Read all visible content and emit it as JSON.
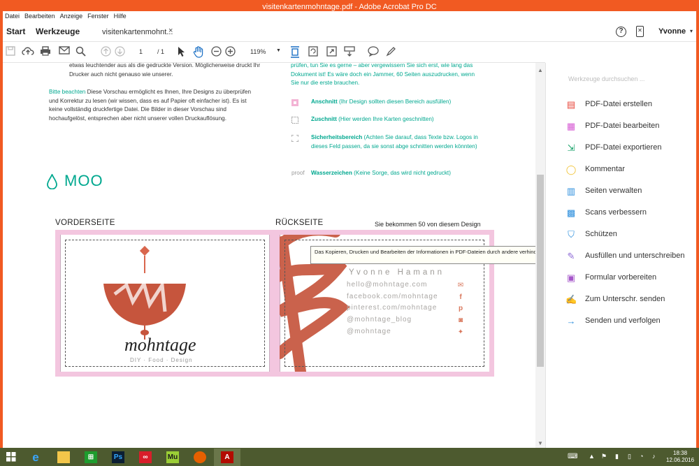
{
  "window": {
    "title": "visitenkartenmohntage.pdf - Adobe Acrobat Pro DC"
  },
  "menu": [
    "Datei",
    "Bearbeiten",
    "Anzeige",
    "Fenster",
    "Hilfe"
  ],
  "tabs": {
    "start": "Start",
    "tools": "Werkzeuge",
    "document": "visitenkartenmohnt...",
    "close": "×"
  },
  "account": {
    "user": "Yvonne"
  },
  "toolbar": {
    "page_current": "1",
    "page_total": "/ 1",
    "zoom": "119%"
  },
  "document": {
    "intro_left": "etwas leuchtender aus als die gedruckte Version. Möglicherweise druckt Ihr Drucker auch nicht genauso wie unserer.",
    "note_label": "Bitte beachten",
    "note_text": " Diese Vorschau ermöglicht es Ihnen, Ihre Designs zu überprüfen und Korrektur zu lesen (wir wissen, dass es auf Papier oft einfacher ist). Es ist keine vollständig druckfertige Datei. Die Bilder in dieser Vorschau sind hochaufgelöst, entsprechen aber nicht unserer vollen Druckauflösung.",
    "intro_right": "prüfen, tun Sie es gerne – aber vergewissern Sie sich erst, wie lang das Dokument ist! Es wäre doch ein Jammer, 60 Seiten auszudrucken, wenn Sie nur die erste brauchen.",
    "legend": [
      {
        "term": "Anschnitt",
        "desc": " (Ihr Design sollten diesen Bereich ausfüllen)"
      },
      {
        "term": "Zuschnitt",
        "desc": " (Hier werden Ihre Karten geschnitten)"
      },
      {
        "term": "Sicherheitsbereich",
        "desc": " (Achten Sie darauf, dass Texte bzw. Logos in dieses Feld passen, da sie sonst abge schnitten werden könnten)"
      },
      {
        "prefix": "proof",
        "term": "Wasserzeichen",
        "desc": " (Keine Sorge, das wird nicht gedruckt)"
      }
    ],
    "brand": "MOO",
    "front_label": "VORDERSEITE",
    "back_label": "RÜCKSEITE",
    "quantity_note": "Sie bekommen 50 von diesem Design",
    "logo_text": "mohntage",
    "logo_tagline": "DIY · Food · Design",
    "card_name": "Yvonne Hamann",
    "contacts": [
      {
        "text": "hello@mohntage.com",
        "icon": "mail-icon"
      },
      {
        "text": "facebook.com/mohntage",
        "icon": "facebook-icon"
      },
      {
        "text": "pinterest.com/mohntage",
        "icon": "pinterest-icon"
      },
      {
        "text": "@mohntage_blog",
        "icon": "instagram-icon"
      },
      {
        "text": "@mohntage",
        "icon": "twitter-icon"
      }
    ],
    "tooltip": "Das Kopieren, Drucken und Bearbeiten der Informationen in PDF-Dateien durch andere verhindern"
  },
  "tools_panel": {
    "search_placeholder": "Werkzeuge durchsuchen ...",
    "items": [
      {
        "label": "PDF-Datei erstellen",
        "icon": "create-pdf-icon",
        "color": "#e8473b"
      },
      {
        "label": "PDF-Datei bearbeiten",
        "icon": "edit-pdf-icon",
        "color": "#d65ad3"
      },
      {
        "label": "PDF-Datei exportieren",
        "icon": "export-pdf-icon",
        "color": "#1aa36b"
      },
      {
        "label": "Kommentar",
        "icon": "comment-icon",
        "color": "#f1c232"
      },
      {
        "label": "Seiten verwalten",
        "icon": "organize-pages-icon",
        "color": "#2d8fdd"
      },
      {
        "label": "Scans verbessern",
        "icon": "enhance-scans-icon",
        "color": "#2d8fdd"
      },
      {
        "label": "Schützen",
        "icon": "protect-icon",
        "color": "#2d8fdd"
      },
      {
        "label": "Ausfüllen und unterschreiben",
        "icon": "fill-sign-icon",
        "color": "#8e6bd6"
      },
      {
        "label": "Formular vorbereiten",
        "icon": "prepare-form-icon",
        "color": "#a556c9"
      },
      {
        "label": "Zum Unterschr. senden",
        "icon": "send-for-signature-icon",
        "color": "#5b6bd6"
      },
      {
        "label": "Senden und verfolgen",
        "icon": "send-track-icon",
        "color": "#2d8fdd"
      }
    ]
  },
  "taskbar": {
    "apps": [
      "ie-icon",
      "explorer-icon",
      "store-icon",
      "photoshop-icon",
      "creative-cloud-icon",
      "muse-icon",
      "firefox-icon",
      "acrobat-icon"
    ],
    "ps_label": "Ps",
    "mu_label": "Mu",
    "time": "18:38",
    "date": "12.06.2016"
  },
  "colors": {
    "accent": "#f15a22",
    "teal": "#00a88f",
    "bleed": "#f3c6df",
    "copper": "#c6553d"
  }
}
